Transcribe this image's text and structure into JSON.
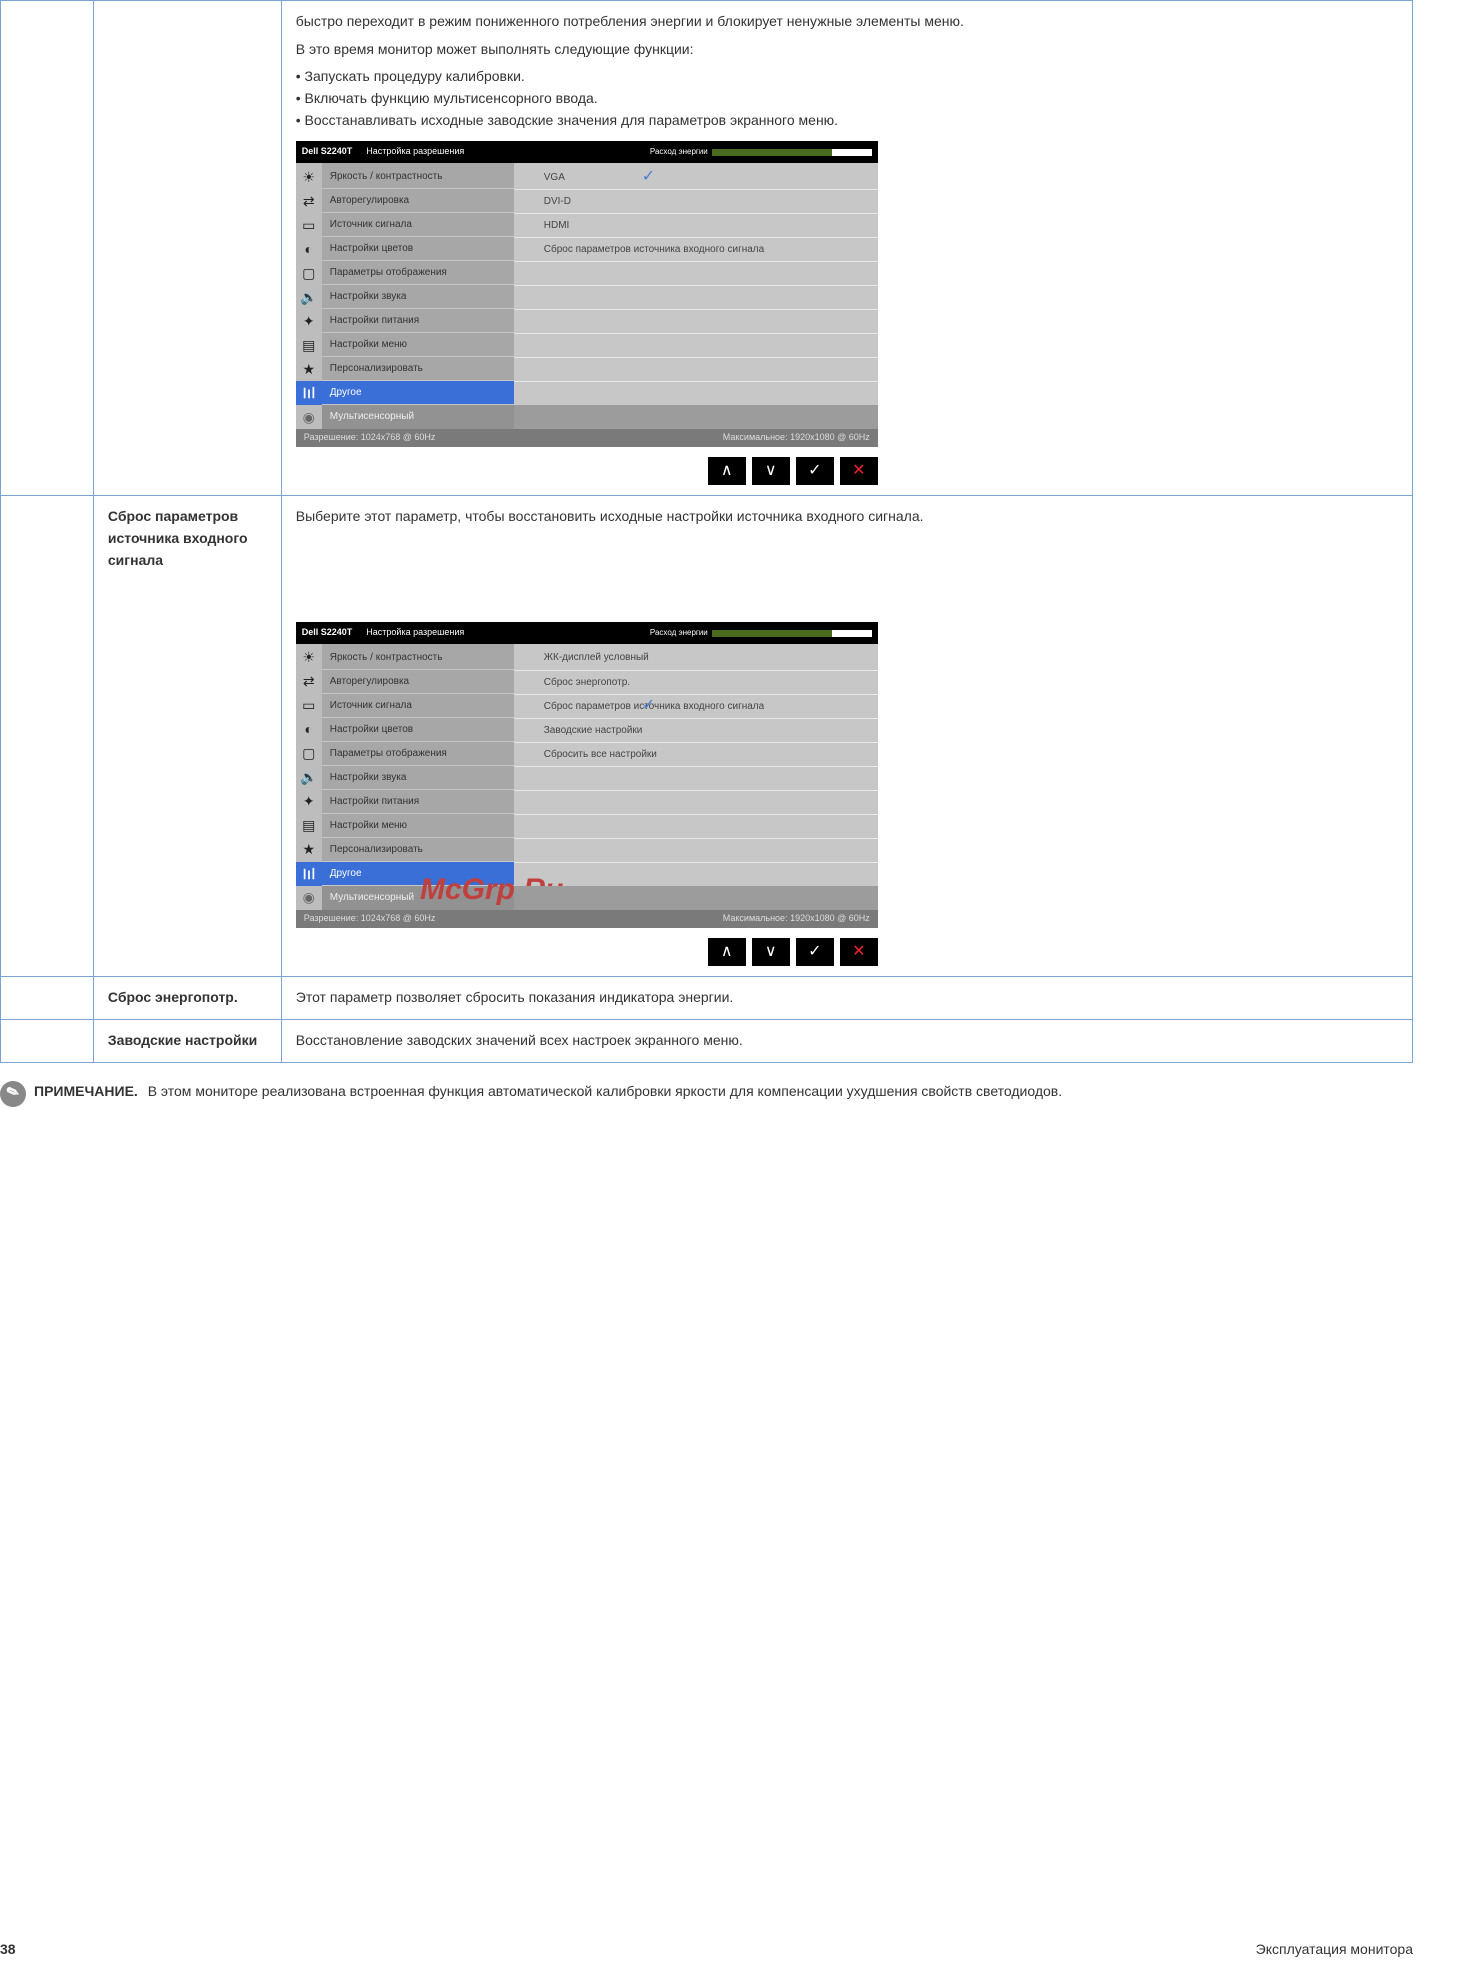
{
  "watermark": "McGrp.Ru",
  "cells": {
    "r1c2": "",
    "r1c3_p1": "быстро переходит в режим пониженного потребления энергии и блокирует ненужные элементы меню.",
    "r1c3_p2": "В это время монитор может выполнять следующие функции:",
    "r1c3_b1": "• Запускать процедуру калибровки.",
    "r1c3_b2": "• Включать функцию мультисенсорного ввода.",
    "r1c3_b3": "• Восстанавливать исходные заводские значения для параметров экранного меню.",
    "r2c2": "Сброс параметров источника входного сигнала",
    "r2c3": "Выберите этот параметр, чтобы восстановить исходные настройки источника входного сигнала.",
    "r3c2": "Сброс энергопотр.",
    "r3c3": "Этот параметр позволяет сбросить показания индикатора энергии.",
    "r4c2": "Заводские настройки",
    "r4c3": "Восстановление заводских значений всех настроек экранного меню."
  },
  "osd": {
    "brand": "Dell S2240T",
    "title": "Настройка разрешения",
    "energy_label": "Расход энергии",
    "res_left": "Разрешение: 1024x768 @ 60Hz",
    "res_right": "Максимальное: 1920x1080 @ 60Hz",
    "categories": [
      "Яркость / контрастность",
      "Авторегулировка",
      "Источник сигнала",
      "Настройки цветов",
      "Параметры отображения",
      "Настройки звука",
      "Настройки питания",
      "Настройки меню",
      "Персонализировать",
      "Другое",
      "Мультисенсорный"
    ],
    "right1": [
      {
        "label": "VGA",
        "checked": true
      },
      {
        "label": "DVI-D",
        "checked": false
      },
      {
        "label": "HDMI",
        "checked": false
      },
      {
        "label": "Сброс параметров источника входного сигнала",
        "checked": false
      }
    ],
    "right2": [
      {
        "label": "ЖК-дисплей условный",
        "checked": false
      },
      {
        "label": "Сброс энергопотр.",
        "checked": false
      },
      {
        "label": "Сброс параметров источника входного сигнала",
        "checked": true
      },
      {
        "label": "Заводские настройки",
        "checked": false
      },
      {
        "label": "Сбросить все настройки",
        "checked": false
      }
    ]
  },
  "note": {
    "label": "ПРИМЕЧАНИЕ.",
    "text": "В этом мониторе реализована встроенная функция автоматической калибровки яркости для компенсации ухудшения свойств светодиодов."
  },
  "footer": {
    "page": "38",
    "section": "Эксплуатация монитора"
  }
}
